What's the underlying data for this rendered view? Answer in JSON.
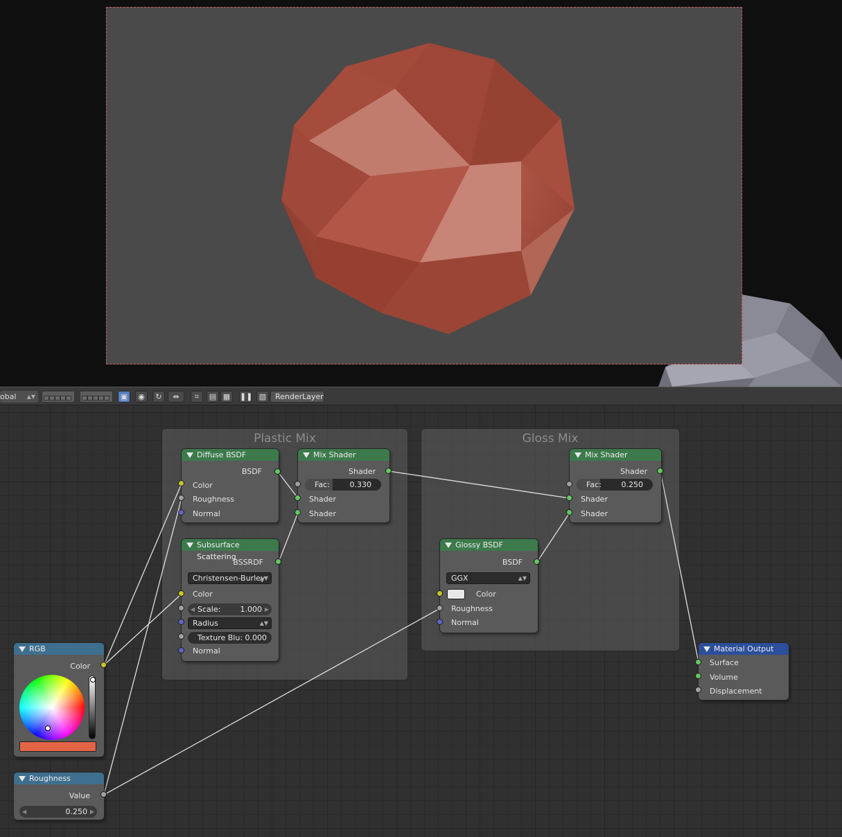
{
  "toolbar": {
    "transform_orientation": "obal",
    "render_layer": "RenderLayer"
  },
  "frames": {
    "plastic_mix": "Plastic Mix",
    "gloss_mix": "Gloss Mix"
  },
  "nodes": {
    "diffuse": {
      "title": "Diffuse BSDF",
      "output": "BSDF",
      "inputs": [
        "Color",
        "Roughness",
        "Normal"
      ]
    },
    "mix1": {
      "title": "Mix Shader",
      "output": "Shader",
      "fac_label": "Fac:",
      "fac_value": "0.330",
      "fac_fraction": 0.33,
      "inputs": [
        "Shader",
        "Shader"
      ]
    },
    "sss": {
      "title": "Subsurface Scattering",
      "output": "BSSRDF",
      "falloff": "Christensen-Burley",
      "color_label": "Color",
      "scale_label": "Scale:",
      "scale_value": "1.000",
      "radius": "Radius",
      "texture_blur": "Texture Blu: 0.000",
      "normal_label": "Normal"
    },
    "mix2": {
      "title": "Mix Shader",
      "output": "Shader",
      "fac_label": "Fac:",
      "fac_value": "0.250",
      "fac_fraction": 0.25,
      "inputs": [
        "Shader",
        "Shader"
      ]
    },
    "glossy": {
      "title": "Glossy BSDF",
      "output": "BSDF",
      "distribution": "GGX",
      "inputs": [
        "Color",
        "Roughness",
        "Normal"
      ],
      "color_swatch": "#e8e8e8"
    },
    "rgb": {
      "title": "RGB",
      "output": "Color",
      "color": "#e46447"
    },
    "roughness": {
      "title": "Roughness",
      "output": "Value",
      "value": "0.250"
    },
    "output": {
      "title": "Material Output",
      "inputs": [
        "Surface",
        "Volume",
        "Displacement"
      ]
    }
  },
  "colors": {
    "shader_header": "#3c7a4c",
    "input_header": "#3f6f8f",
    "output_header": "#2b4f9a",
    "socket_color": "#c7c729",
    "socket_shader": "#63c763",
    "socket_value": "#a1a1a1",
    "socket_vector": "#6363c7",
    "sphere": "#b4513f"
  }
}
